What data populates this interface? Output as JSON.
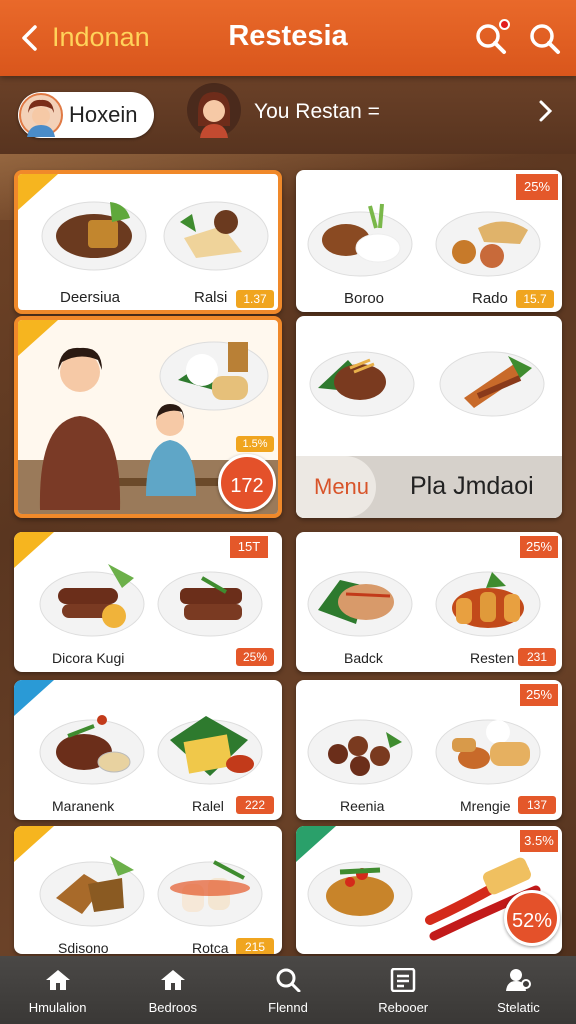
{
  "topbar": {
    "brand": "Indonan",
    "title": "Restesia"
  },
  "user": {
    "chip_label": "Hoxein",
    "rest_label": "You Restan ="
  },
  "cards": {
    "c1": {
      "left_label": "Deersiua",
      "right_label": "Ralsi",
      "price": "1.37"
    },
    "c2": {
      "corner": "25%",
      "left_label": "Boroo",
      "right_label": "Rado",
      "price": "15.7"
    },
    "c3": {
      "small": "1.5%",
      "badge": "172"
    },
    "c4": {
      "menu": "Menu",
      "menu_text": "Pla Jmdaoi"
    },
    "c5": {
      "corner": "15T",
      "left_label": "Dicora Kugi",
      "price": "25%"
    },
    "c6": {
      "corner": "25%",
      "left_label": "Badck",
      "right_label": "Resten",
      "price": "231"
    },
    "c7": {
      "left_label": "Maranenk",
      "right_label": "Ralel",
      "price": "222"
    },
    "c8": {
      "corner": "25%",
      "left_label": "Reenia",
      "right_label": "Mrengie",
      "price": "137"
    },
    "c9": {
      "left_label": "Sdisono",
      "right_label": "Rotca",
      "price": "215"
    },
    "c10": {
      "corner": "3.5%",
      "badge": "52%"
    }
  },
  "nav": [
    {
      "label": "Hmulalion",
      "icon": "home-icon"
    },
    {
      "label": "Bedroos",
      "icon": "home-icon"
    },
    {
      "label": "Flennd",
      "icon": "search-icon"
    },
    {
      "label": "Rebooer",
      "icon": "list-icon"
    },
    {
      "label": "Stelatic",
      "icon": "profile-icon"
    }
  ],
  "colors": {
    "accent": "#e9692a",
    "brand_text": "#ffd35a",
    "nav_bg": "#3f3d3b"
  }
}
